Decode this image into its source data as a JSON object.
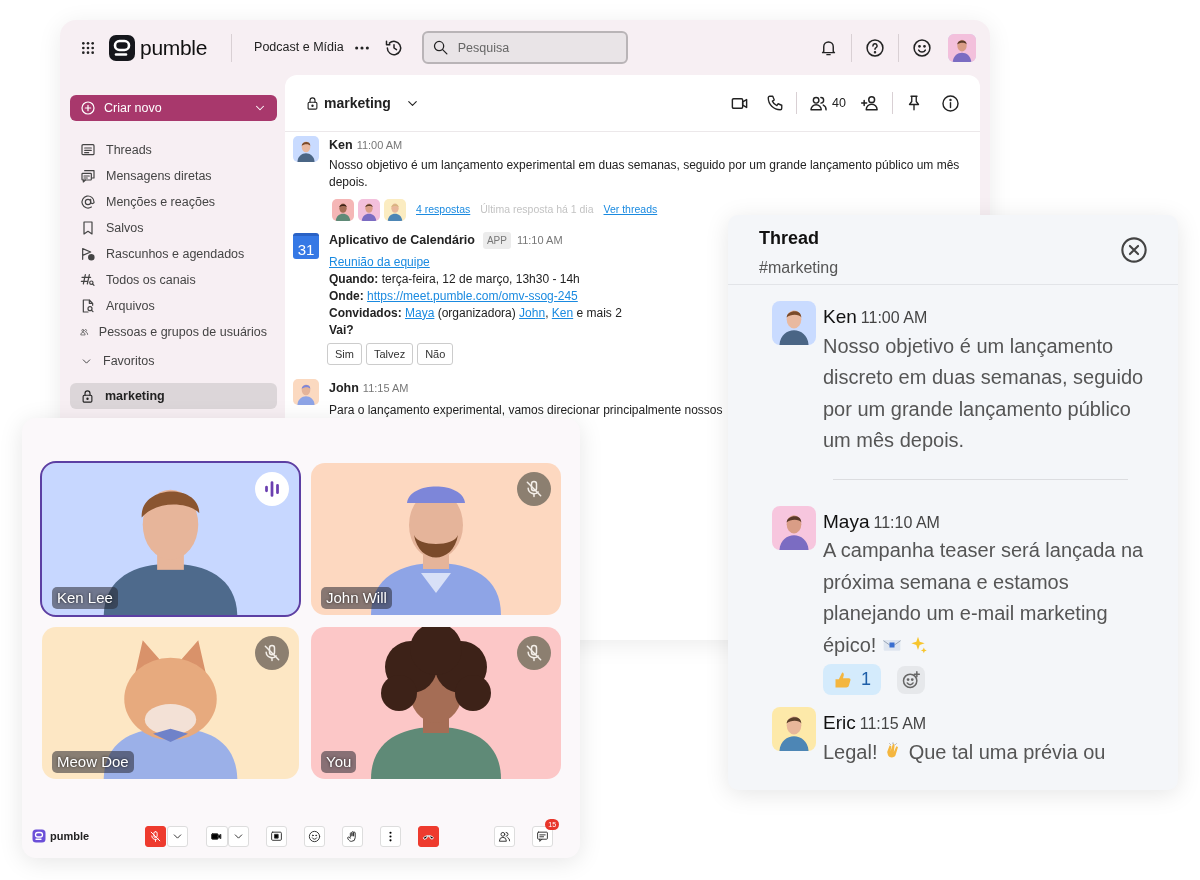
{
  "topbar": {
    "logo": "pumble",
    "workspace": "Podcast e Mídia",
    "search": {
      "placeholder": "Pesquisa"
    }
  },
  "sidebar": {
    "create_button": "Criar novo",
    "items": [
      {
        "label": "Threads"
      },
      {
        "label": "Mensagens diretas"
      },
      {
        "label": "Menções e reações"
      },
      {
        "label": "Salvos"
      },
      {
        "label": "Rascunhos e agendados"
      },
      {
        "label": "Todos os canais"
      },
      {
        "label": "Arquivos"
      },
      {
        "label": "Pessoas e grupos de usuários"
      }
    ],
    "favorites": {
      "label": "Favoritos",
      "expanded": true
    },
    "channels": [
      {
        "label": "marketing",
        "selected": true
      }
    ]
  },
  "channel": {
    "name": "marketing",
    "member_count": "40"
  },
  "messages": [
    {
      "kind": "text",
      "author": "Ken",
      "time": "11:00 AM",
      "text": "Nosso objetivo é um lançamento experimental em duas semanas, seguido por um grande lançamento público um mês depois.",
      "replies": {
        "count": "4 respostas",
        "last_reply": "Última resposta há 1 dia",
        "link": "Ver threads"
      }
    },
    {
      "kind": "calendar",
      "author": "Aplicativo de Calendário",
      "badge": "APP",
      "time": "11:10 AM",
      "icon_text": "31",
      "title": "Reunião da equipe",
      "lines": [
        [
          {
            "kind": "label",
            "text": "Quando:"
          },
          {
            "kind": "plain",
            "text": "terça-feira, 12 de março, 13h30 - 14h"
          }
        ],
        [
          {
            "kind": "label",
            "text": "Onde:"
          },
          {
            "kind": "link",
            "text": "https://meet.pumble.com/omv-ssog-245"
          }
        ],
        [
          {
            "kind": "label",
            "text": "Convidados:"
          },
          {
            "kind": "link",
            "text": "Maya"
          },
          {
            "kind": "plain",
            "text": "(organizadora)"
          },
          {
            "kind": "link",
            "text": "John"
          },
          {
            "kind": "plain",
            "text": ",",
            "attached": true
          },
          {
            "kind": "link",
            "text": "Ken"
          },
          {
            "kind": "plain",
            "text": "e mais 2"
          }
        ]
      ],
      "question": "Vai?",
      "buttons": [
        "Sim",
        "Talvez",
        "Não"
      ]
    },
    {
      "kind": "text",
      "author": "John",
      "time": "11:15 AM",
      "text": "Para o lançamento experimental, vamos direcionar principalmente nossos"
    }
  ],
  "call": {
    "tiles": [
      {
        "name": "Ken Lee",
        "selected": true,
        "muted": false
      },
      {
        "name": "John Will",
        "selected": false,
        "muted": true
      },
      {
        "name": "Meow Doe",
        "selected": false,
        "muted": true
      },
      {
        "name": "You",
        "selected": false,
        "muted": true
      }
    ],
    "bar": {
      "logo": "pumble",
      "mic_muted": true,
      "chat_badge": "15"
    }
  },
  "thread": {
    "title": "Thread",
    "channel": "#marketing",
    "messages": [
      {
        "author": "Ken",
        "time": "11:00 AM",
        "parts": [
          {
            "kind": "text",
            "text": "Nosso objetivo é um lançamento discreto em duas semanas, seguido por um grande lançamento público um mês depois."
          }
        ]
      },
      {
        "author": "Maya",
        "time": "11:10 AM",
        "parts": [
          {
            "kind": "text",
            "text": "A campanha teaser será lançada na próxima semana e estamos planejando um e-mail marketing épico!"
          },
          {
            "kind": "emoji"
          },
          {
            "kind": "emoji"
          }
        ],
        "reactions": [
          {
            "count": "1",
            "selected": true
          }
        ]
      },
      {
        "author": "Eric",
        "time": "11:15 AM",
        "parts": [
          {
            "kind": "text",
            "text": "Legal!"
          },
          {
            "kind": "emoji"
          },
          {
            "kind": "text",
            "text": "Que tal uma prévia ou"
          }
        ]
      }
    ]
  }
}
